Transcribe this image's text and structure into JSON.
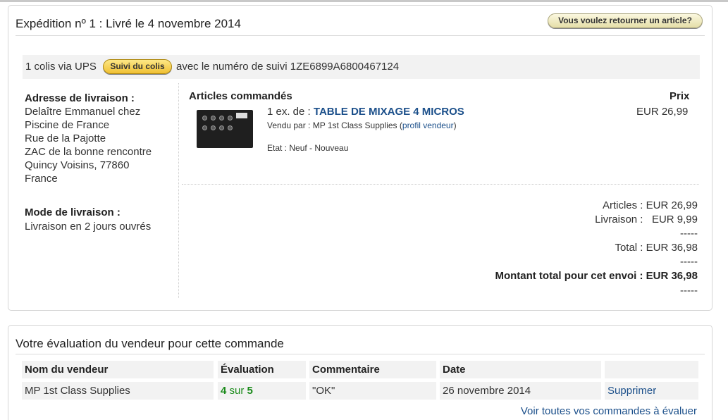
{
  "shipment": {
    "title": "Expédition nº 1 : Livré le 4 novembre 2014",
    "return_button": "Vous voulez retourner un article?",
    "tracking": {
      "prefix": "1 colis via UPS",
      "button": "Suivi du colis",
      "suffix": "avec le numéro de suivi 1ZE6899A6800467124"
    },
    "address_label": "Adresse de livraison :",
    "address_lines": [
      "Delaître Emmanuel chez",
      "Piscine de France",
      "Rue de la Pajotte",
      "ZAC de la bonne rencontre",
      "Quincy Voisins, 77860",
      "France"
    ],
    "mode_label": "Mode de livraison :",
    "mode_value": "Livraison en 2 jours ouvrés",
    "articles_header": "Articles commandés",
    "price_header": "Prix",
    "item": {
      "qty": "1 ex. de :",
      "name": "TABLE DE MIXAGE 4 MICROS",
      "seller_prefix": "Vendu par : MP 1st Class Supplies (",
      "seller_link": "profil vendeur",
      "seller_suffix": ")",
      "state": "Etat : Neuf - Nouveau",
      "price": "EUR 26,99"
    },
    "totals": {
      "articles": "Articles : EUR 26,99",
      "livraison": "Livraison :   EUR 9,99",
      "dash1": "-----",
      "total": "Total : EUR 36,98",
      "dash2": "-----",
      "grand": "Montant total pour cet envoi : EUR 36,98",
      "dash3": "-----"
    }
  },
  "evaluation": {
    "title": "Votre évaluation du vendeur pour cette commande",
    "headers": [
      "Nom du vendeur",
      "Évaluation",
      "Commentaire",
      "Date",
      ""
    ],
    "row": {
      "seller": "MP 1st Class Supplies",
      "score": "4",
      "sur": "sur",
      "max": "5",
      "comment": "\"OK\"",
      "date": "26 novembre 2014",
      "delete": "Supprimer"
    },
    "view_all": "Voir toutes vos commandes à évaluer"
  },
  "colors": {
    "link": "#1b4f8a",
    "rating_green": "#1a8a1a",
    "track_button": "#f0c033"
  }
}
